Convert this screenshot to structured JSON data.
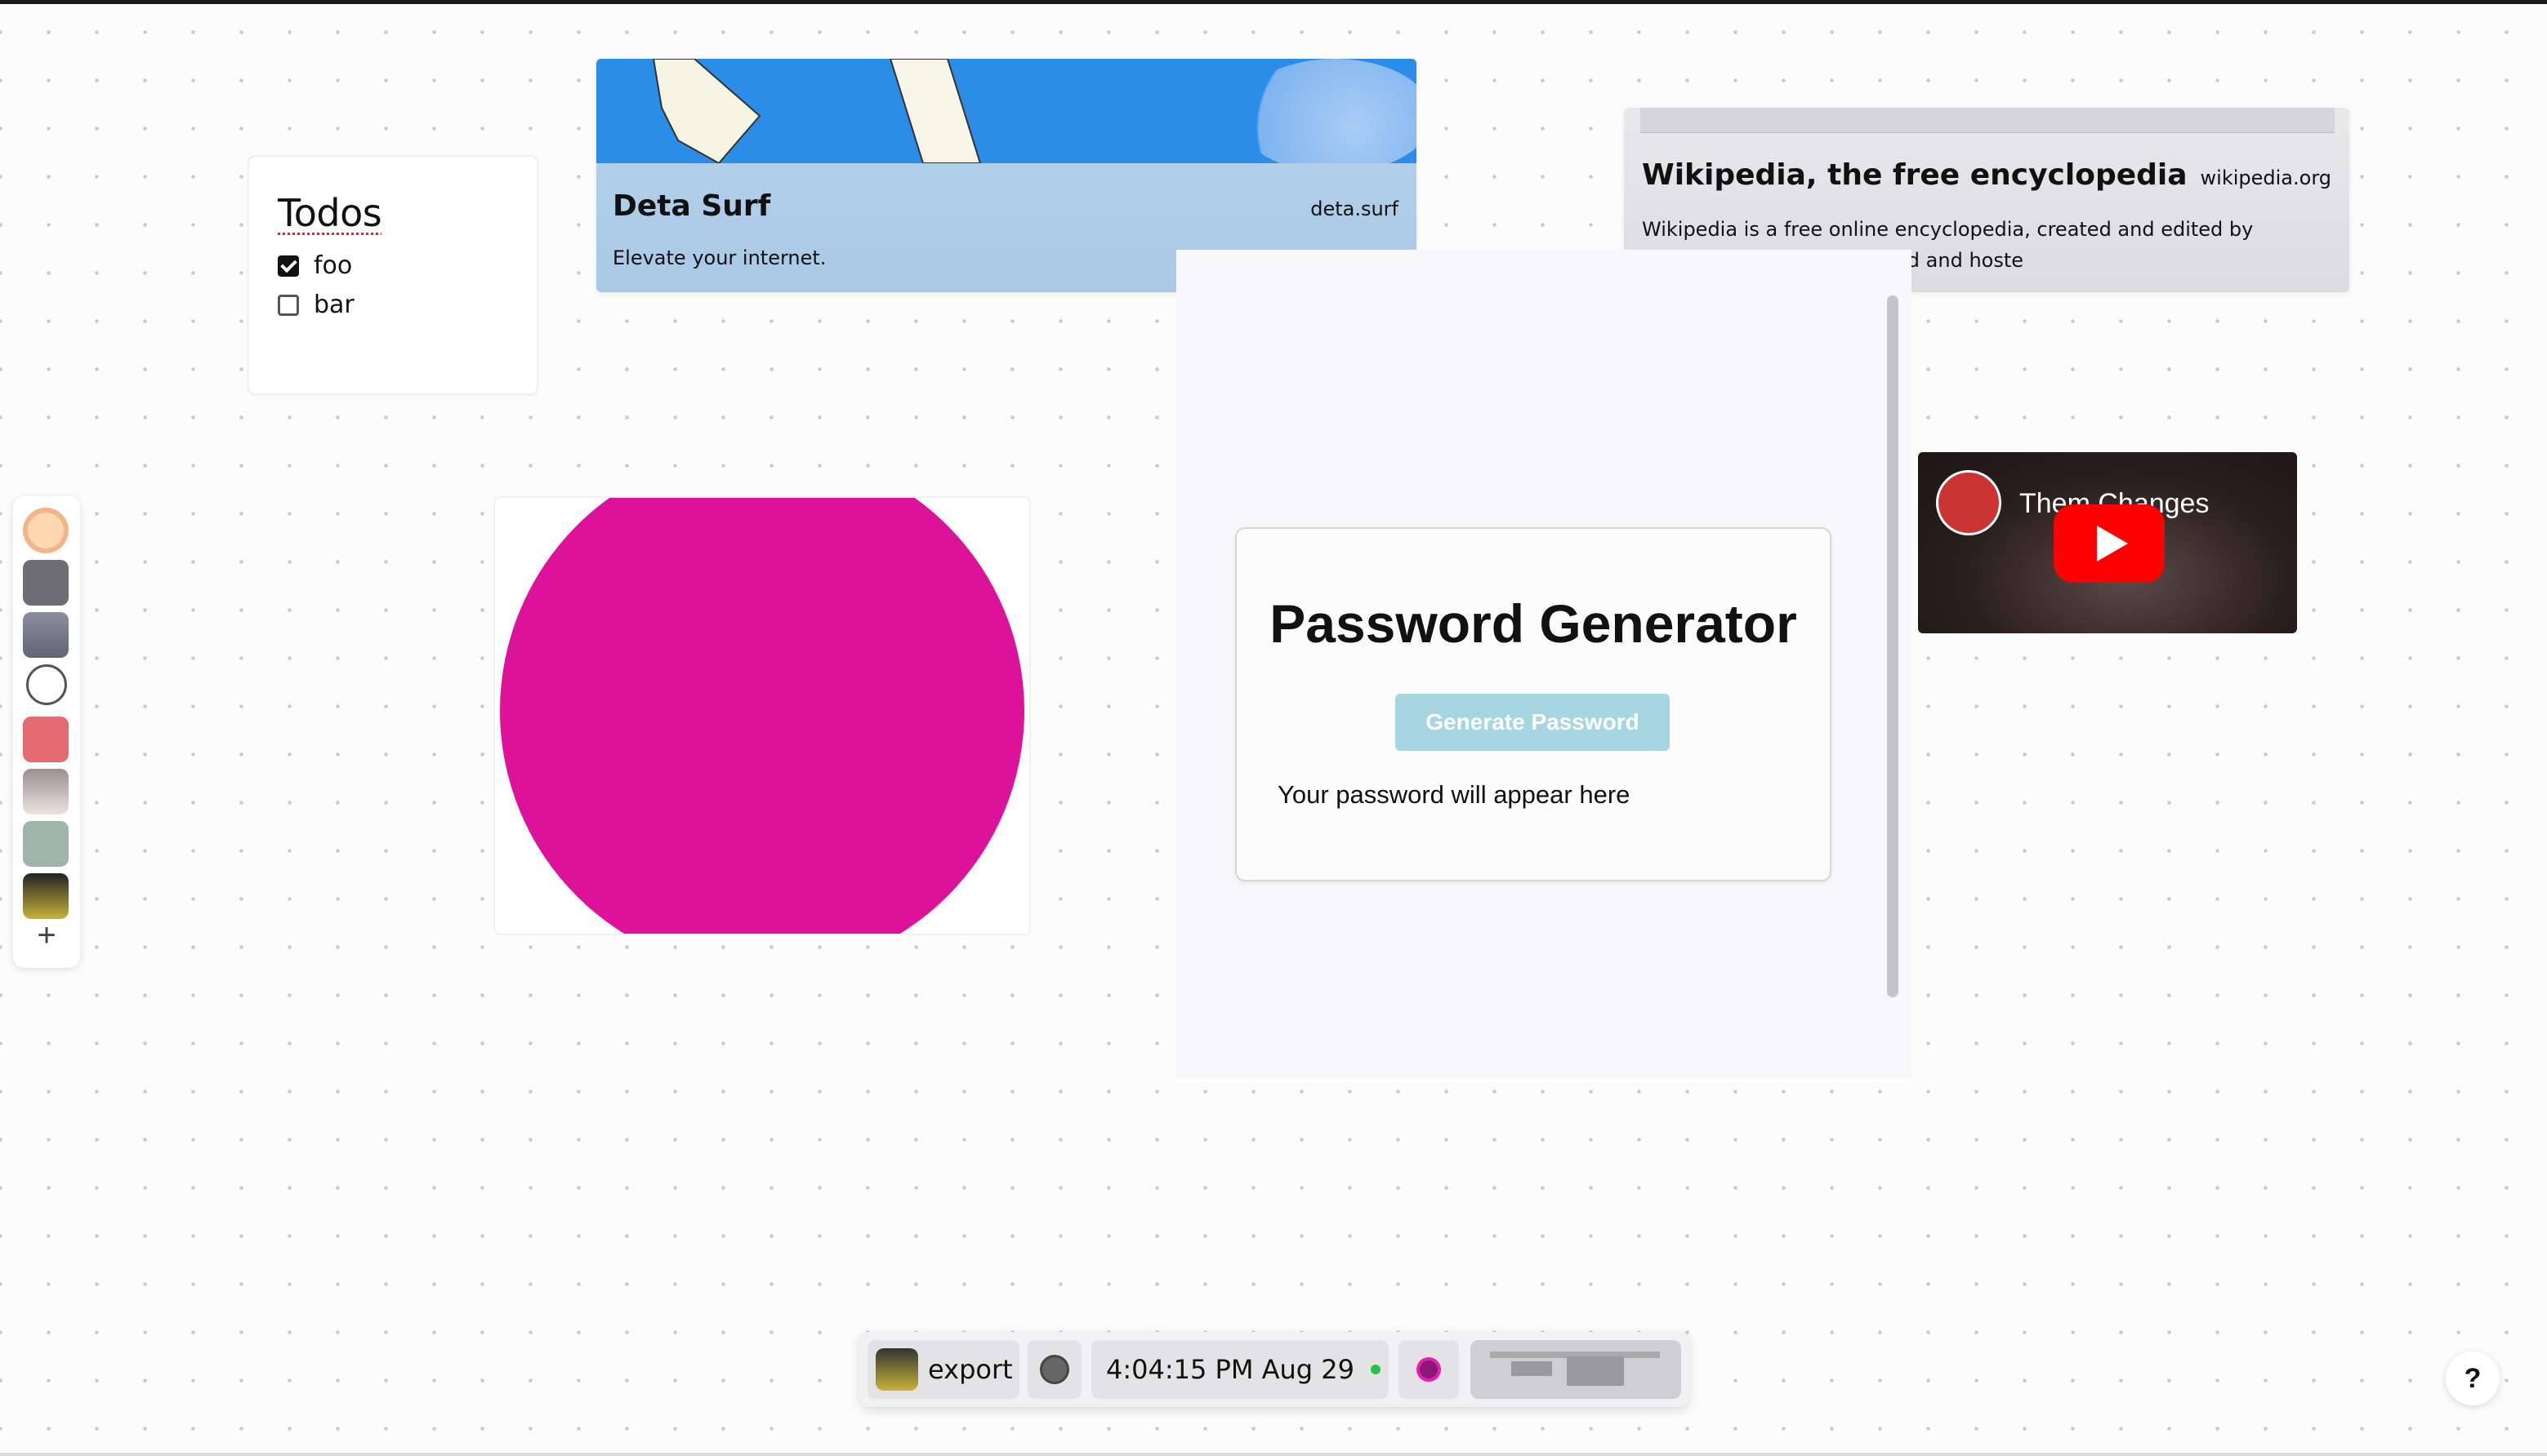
{
  "todos": {
    "title": "Todos",
    "items": [
      {
        "label": "foo",
        "checked": true
      },
      {
        "label": "bar",
        "checked": false
      }
    ]
  },
  "deta_card": {
    "title": "Deta Surf",
    "domain": "deta.surf",
    "description": "Elevate your internet."
  },
  "wiki_card": {
    "title": "Wikipedia, the free encyclopedia",
    "domain": "wikipedia.org",
    "description": "Wikipedia is a free online encyclopedia, created and edited by volunteers around the world and hoste"
  },
  "shape": {
    "color": "#dc139a"
  },
  "password_generator": {
    "title": "Password Generator",
    "button_label": "Generate Password",
    "output_text": "Your password will appear here"
  },
  "youtube": {
    "title": "Them Changes",
    "icon": "play-icon"
  },
  "dock": {
    "items": [
      "avatar-peach",
      "app-gray",
      "avatar-portrait",
      "clock-icon",
      "app-red",
      "avatar-cat",
      "app-green",
      "avatar-cat-dark"
    ],
    "add_label": "+"
  },
  "bottom_bar": {
    "export_label": "export",
    "time": "4:04:15 PM Aug 29",
    "status_color": "#27c24c"
  },
  "help_label": "?"
}
